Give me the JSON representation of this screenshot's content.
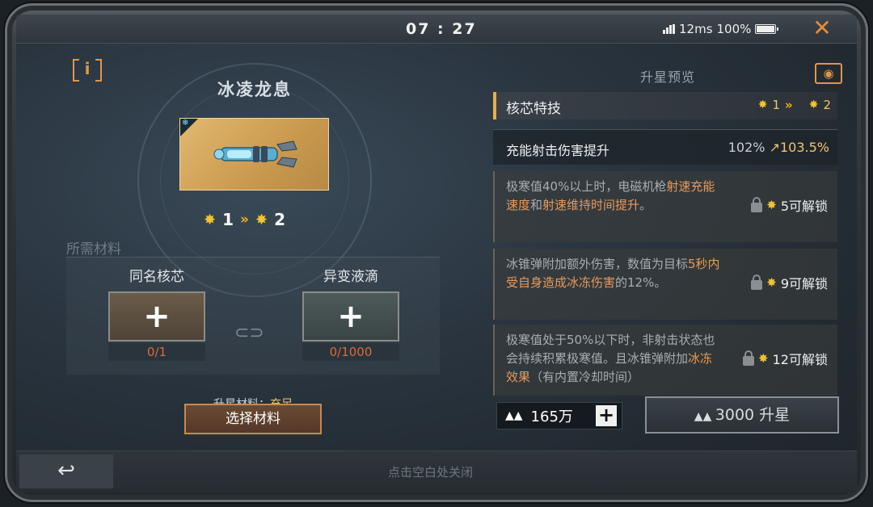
{
  "status_bar": {
    "time": "07 : 27",
    "ping": "12ms",
    "battery": "100%"
  },
  "item": {
    "name": "冰凌龙息",
    "star_from": "1",
    "star_to": "2"
  },
  "materials": {
    "title": "所需材料",
    "slots": [
      {
        "label": "同名核芯",
        "count": "0/1"
      },
      {
        "label": "异变液滴",
        "count": "0/1000"
      }
    ],
    "status_label": "升星材料：",
    "status_value": "充足",
    "select_button": "选择材料"
  },
  "preview": {
    "title": "升星预览",
    "core_label": "核芯特技",
    "core_star_from": "1",
    "core_star_to": "2",
    "effect": {
      "label": "充能射击伤害提升",
      "from": "102%",
      "to": "103.5%"
    },
    "skills": [
      {
        "desc_parts": [
          {
            "t": "极寒值40%以上时，电磁机枪",
            "hl": false
          },
          {
            "t": "射速充能速度",
            "hl": true
          },
          {
            "t": "和",
            "hl": false
          },
          {
            "t": "射速维持时间提升",
            "hl": true
          },
          {
            "t": "。",
            "hl": false
          }
        ],
        "unlock": "5可解锁"
      },
      {
        "desc_parts": [
          {
            "t": "冰锥弹附加额外伤害，数值为目标",
            "hl": false
          },
          {
            "t": "5秒内受自身造成冰冻伤害",
            "hl": true
          },
          {
            "t": "的12%。",
            "hl": false
          }
        ],
        "unlock": "9可解锁"
      },
      {
        "desc_parts": [
          {
            "t": "极寒值",
            "hl": false
          },
          {
            "t": "处于50%以下时，非射击状态也会持续积累极寒值。且冰锥弹附加",
            "hl": false
          },
          {
            "t": "冰冻效果",
            "hl": true
          },
          {
            "t": "（有内置冷却时间）",
            "hl": false
          }
        ],
        "unlock": "12可解锁"
      }
    ],
    "currency": "165万",
    "upgrade_button": "3000 升星"
  },
  "footer": {
    "close_hint": "点击空白处关闭"
  },
  "colors": {
    "accent_orange": "#e0964a",
    "star_gold": "#f2c230",
    "highlight": "#e89a5a"
  }
}
